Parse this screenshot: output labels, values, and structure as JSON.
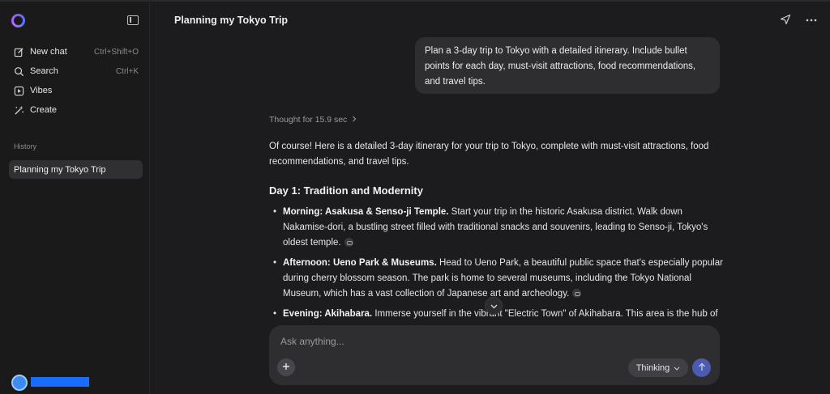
{
  "sidebar": {
    "nav": [
      {
        "label": "New chat",
        "shortcut": "Ctrl+Shift+O",
        "icon": "edit-icon"
      },
      {
        "label": "Search",
        "shortcut": "Ctrl+K",
        "icon": "search-icon"
      },
      {
        "label": "Vibes",
        "shortcut": "",
        "icon": "play-icon"
      },
      {
        "label": "Create",
        "shortcut": "",
        "icon": "sparkle-wand-icon"
      }
    ],
    "history_label": "History",
    "history_items": [
      "Planning my Tokyo Trip"
    ]
  },
  "header": {
    "title": "Planning my Tokyo Trip"
  },
  "conversation": {
    "user_message": "Plan a 3-day trip to Tokyo with a detailed itinerary. Include bullet points for each day, must-visit attractions, food recommendations, and travel tips.",
    "thought": "Thought for 15.9 sec",
    "intro": "Of course! Here is a detailed 3-day itinerary for your trip to Tokyo, complete with must-visit attractions, food recommendations, and travel tips.",
    "day1_heading": "Day 1: Tradition and Modernity",
    "day1_items": [
      {
        "title": "Morning: Asakusa & Senso-ji Temple.",
        "text": " Start your trip in the historic Asakusa district. Walk down Nakamise-dori, a bustling street filled with traditional snacks and souvenirs, leading to Senso-ji, Tokyo's oldest temple."
      },
      {
        "title": "Afternoon: Ueno Park & Museums.",
        "text": " Head to Ueno Park, a beautiful public space that's especially popular during cherry blossom season. The park is home to several museums, including the Tokyo National Museum, which has a vast collection of Japanese art and archeology."
      },
      {
        "title": "Evening: Akihabara.",
        "text": " Immerse yourself in the vibrant \"Electric Town\" of Akihabara. This area is the hub of"
      }
    ]
  },
  "composer": {
    "placeholder": "Ask anything...",
    "mode_label": "Thinking"
  },
  "colors": {
    "accent": "#4a5bb0",
    "background": "#1c1c1e",
    "sidebar": "#1a1a1b"
  }
}
